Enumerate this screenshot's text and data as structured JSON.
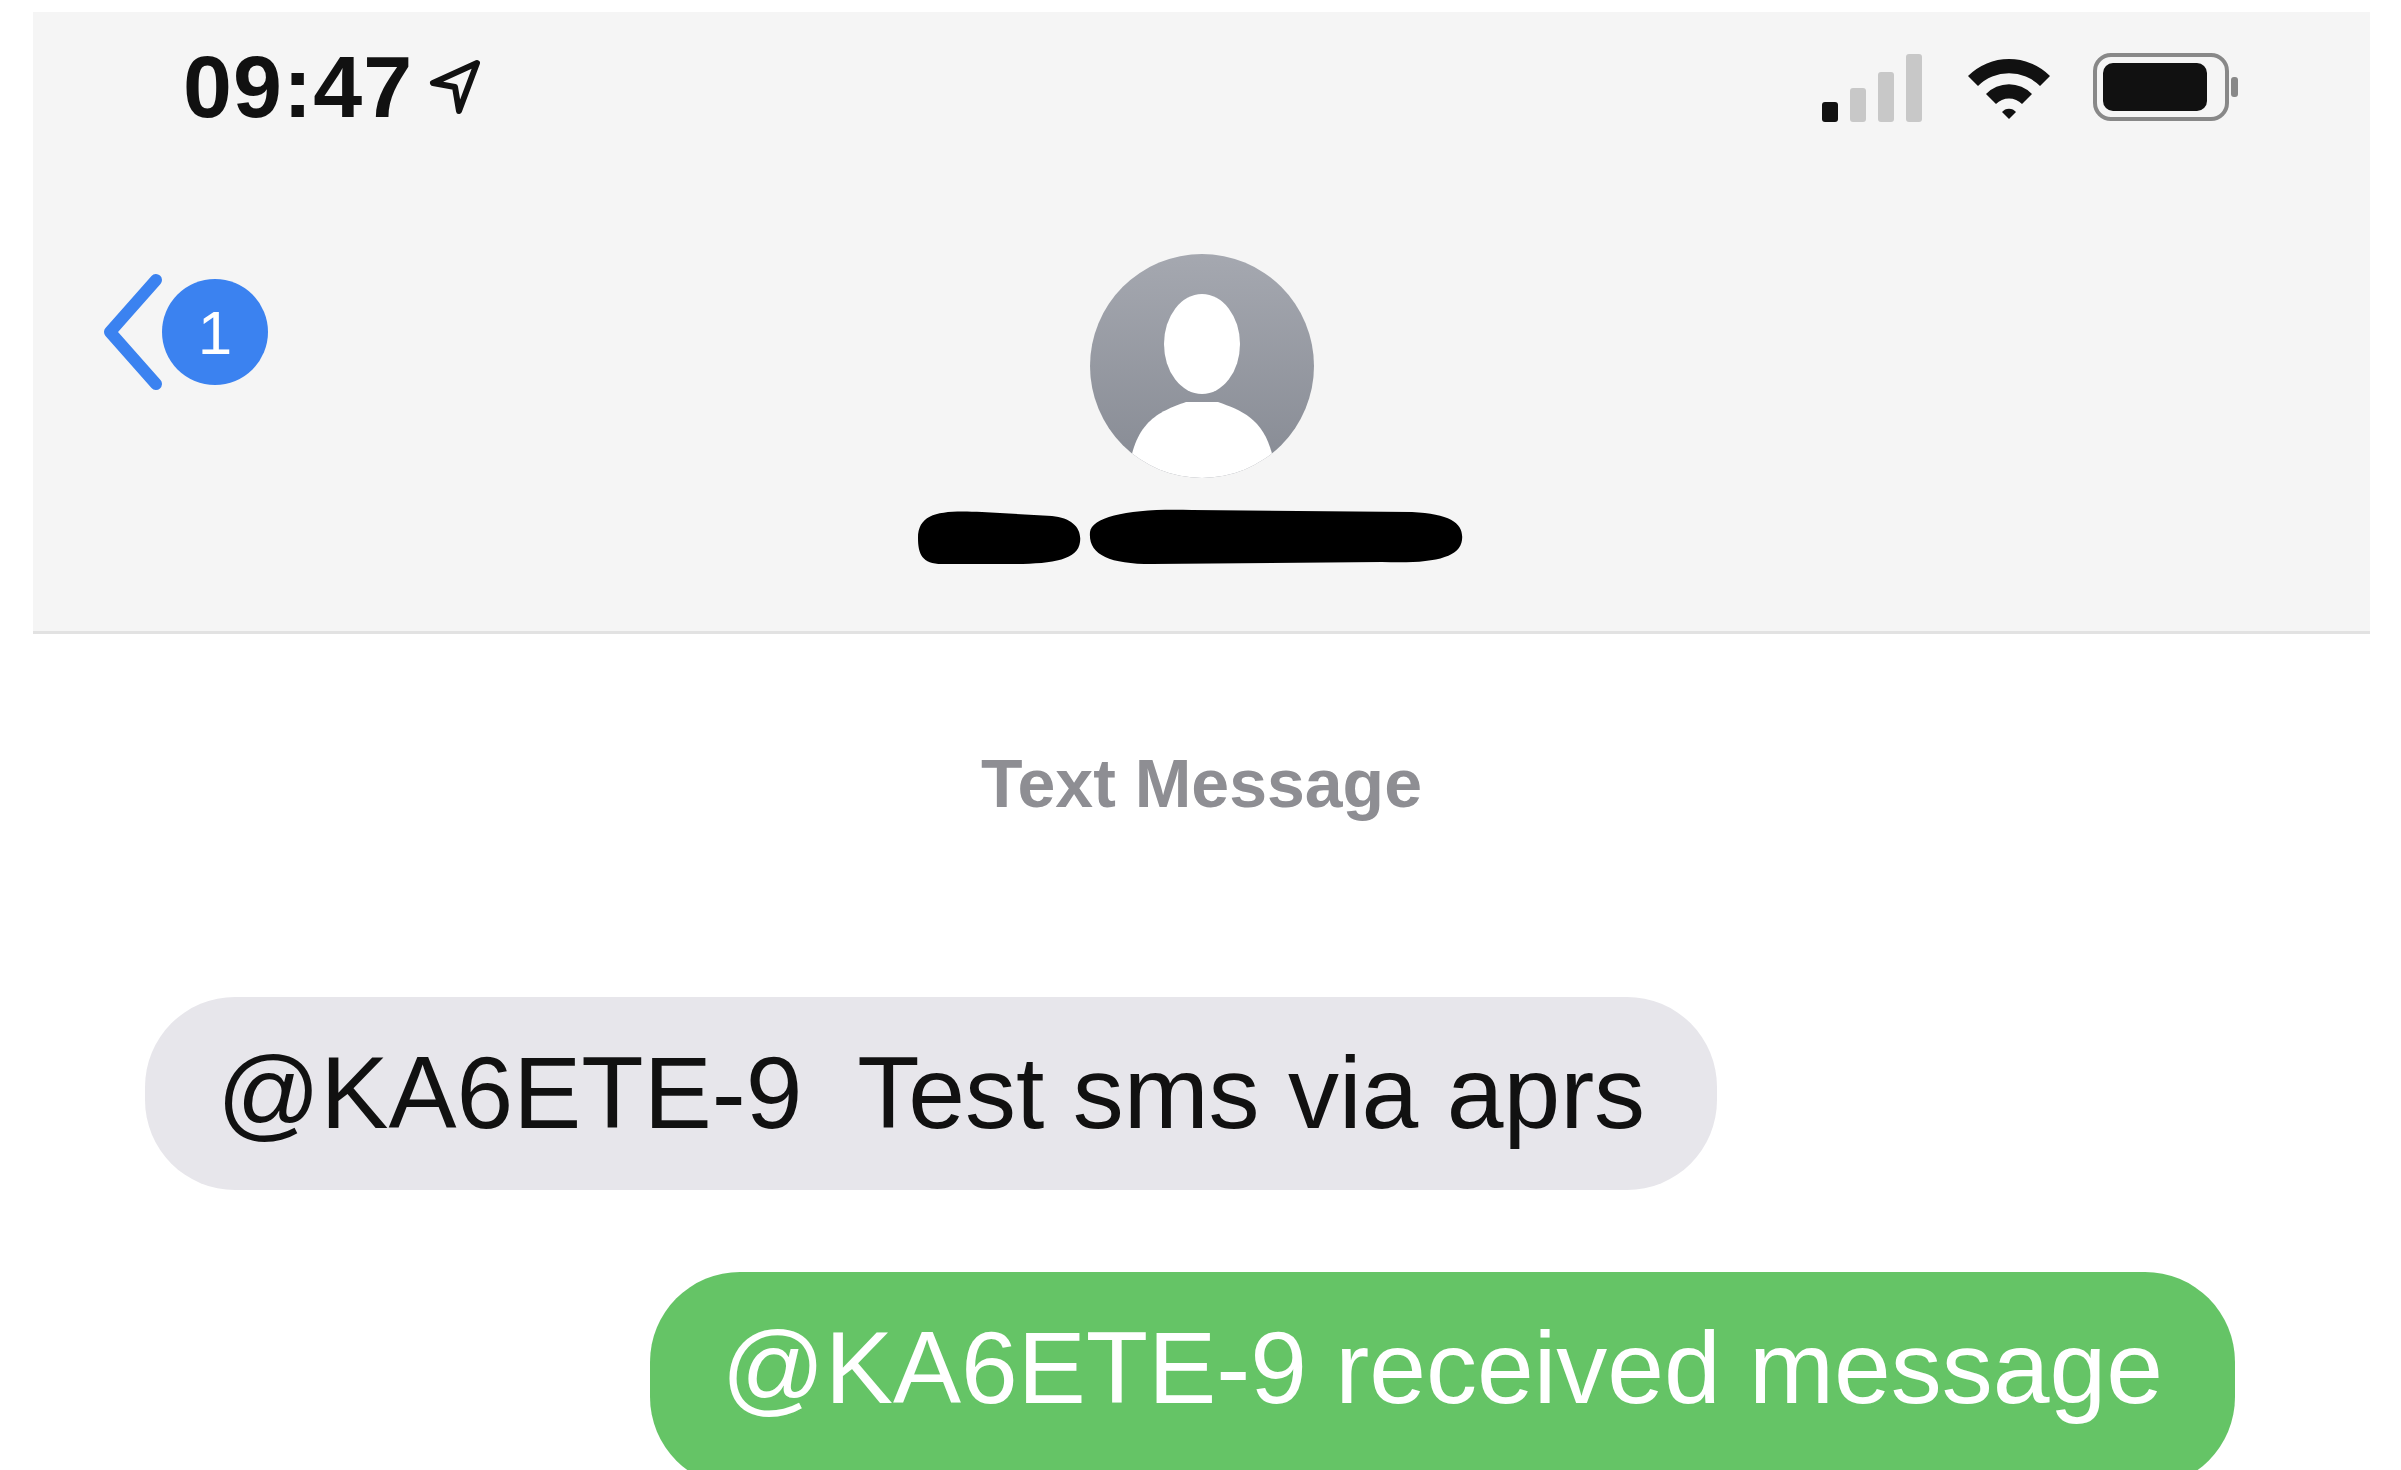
{
  "status_bar": {
    "time": "09:47"
  },
  "nav": {
    "back_badge": "1"
  },
  "thread": {
    "service_label": "Text Message",
    "messages": [
      {
        "kind": "incoming",
        "text": "@KA6ETE-9  Test sms via aprs"
      },
      {
        "kind": "outgoing",
        "text": "@KA6ETE-9 received message"
      }
    ]
  }
}
